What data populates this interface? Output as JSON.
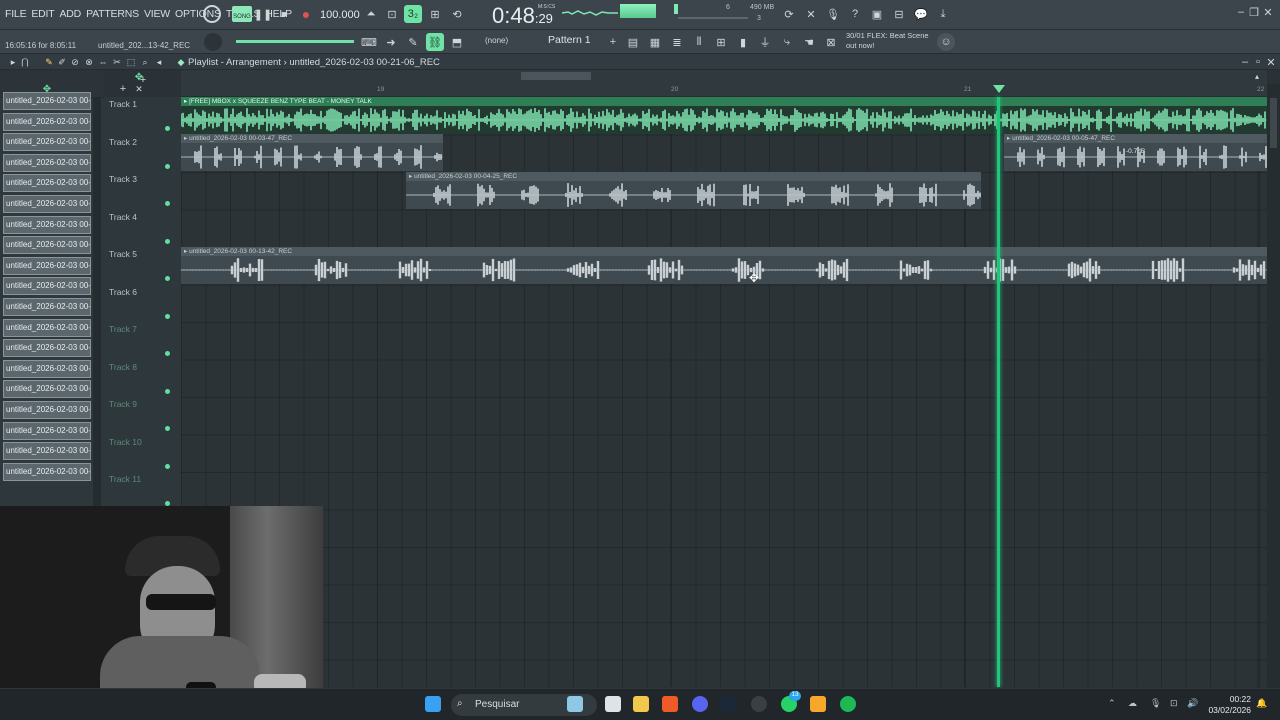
{
  "menu": [
    "FILE",
    "EDIT",
    "ADD",
    "PATTERNS",
    "VIEW",
    "OPTIONS",
    "TOOLS",
    "HELP"
  ],
  "transport": {
    "song_label": "SONG",
    "bpm": "100.000",
    "time_main": "0:48",
    "time_sub": "29",
    "time_tag": "M:S:CS"
  },
  "meters": {
    "memory": "490 MB",
    "voices": "3",
    "cpu_num": "6"
  },
  "hint_left": "16:05:16 for 8:05:11",
  "hint_file": "untitled_202...13-42_REC",
  "channel_select": "(none)",
  "pattern": "Pattern 1",
  "news": {
    "line1": "30/01  FLEX: Beat Scene",
    "line2": "out now!"
  },
  "window": {
    "title_prefix": "Playlist - Arrangement",
    "title_sep": "›",
    "title_file": "untitled_2026-02-03 00-21-06_REC"
  },
  "browser_items": [
    "untitled_2026-02-03 00-...",
    "untitled_2026-02-03 00-...",
    "untitled_2026-02-03 00-...",
    "untitled_2026-02-03 00-...",
    "untitled_2026-02-03 00-...",
    "untitled_2026-02-03 00-...",
    "untitled_2026-02-03 00-...",
    "untitled_2026-02-03 00-...",
    "untitled_2026-02-03 00-...",
    "untitled_2026-02-03 00-...",
    "untitled_2026-02-03 00-...",
    "untitled_2026-02-03 00-...",
    "untitled_2026-02-03 00-...",
    "untitled_2026-02-03 00-...",
    "untitled_2026-02-03 00-...",
    "untitled_2026-02-03 00-...",
    "untitled_2026-02-03 00-...",
    "untitled_2026-02-03 00-...",
    "untitled_2026-02-03 00-..."
  ],
  "ruler": [
    "19",
    "20",
    "21",
    "22"
  ],
  "tracks": [
    "Track 1",
    "Track 2",
    "Track 3",
    "Track 4",
    "Track 5",
    "Track 6",
    "Track 7",
    "Track 8",
    "Track 9",
    "Track 10",
    "Track 11"
  ],
  "clips": {
    "beat": "[FREE] MBOX x SQUEEZE BENZ TYPE BEAT - MONEY TALK",
    "t2a": "untitled_2026-02-03 00-03-47_REC",
    "t2b": "untitled_2026-02-03 00-05-47_REC",
    "t2b_db": "-0.7dB",
    "t3": "untitled_2026-02-03 00-04-25_REC",
    "t5": "untitled_2026-02-03 00-13-42_REC"
  },
  "taskbar": {
    "search": "Pesquisar",
    "time": "00:22",
    "date": "03/02/2026",
    "badge": "13"
  }
}
